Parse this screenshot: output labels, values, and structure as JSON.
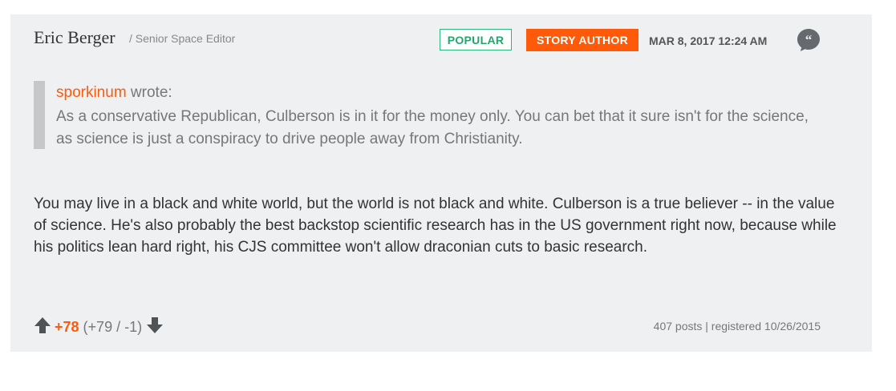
{
  "author": {
    "name": "Eric Berger",
    "title": "/ Senior Space Editor"
  },
  "badges": {
    "popular": "POPULAR",
    "story_author": "STORY AUTHOR"
  },
  "timestamp": "MAR 8, 2017 12:24 AM",
  "icons": {
    "quote": "quote-icon",
    "upvote": "up-arrow-icon",
    "downvote": "down-arrow-icon"
  },
  "colors": {
    "accent": "#ff5a0a",
    "popular_green": "#1fa86a",
    "card_bg": "#eef0f2"
  },
  "quote": {
    "user": "sporkinum",
    "wrote": " wrote:",
    "text": "As a conservative Republican, Culberson is in it for the money only. You can bet that it sure isn't for the science, as science is just a conspiracy to drive people away from Christianity."
  },
  "body": "You may live in a black and white world, but the world is not black and white. Culberson is a true believer -- in the value of science. He's also probably the best backstop scientific research has in the US government right now, because while his politics lean hard right, his CJS committee won't allow draconian cuts to basic research.",
  "votes": {
    "score": "+78",
    "breakdown": "(+79 / -1)"
  },
  "user_stats": "407 posts | registered 10/26/2015"
}
